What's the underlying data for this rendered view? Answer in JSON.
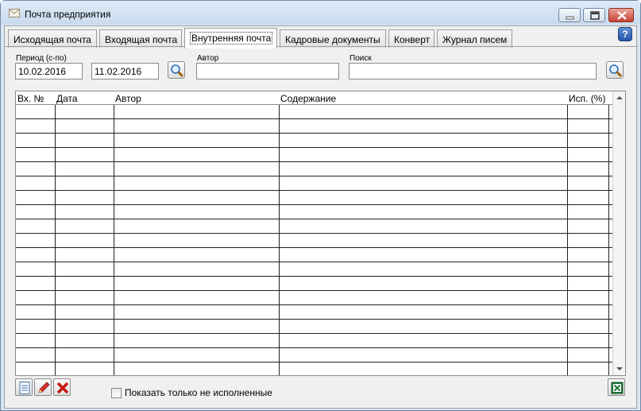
{
  "window": {
    "title": "Почта предприятия"
  },
  "tabs": [
    {
      "label": "Исходящая почта"
    },
    {
      "label": "Входящая почта"
    },
    {
      "label": "Внутренняя почта",
      "active": true
    },
    {
      "label": "Кадровые документы"
    },
    {
      "label": "Конверт"
    },
    {
      "label": "Журнал писем"
    }
  ],
  "help": {
    "label": "?"
  },
  "filters": {
    "period_label": "Период (с-по)",
    "date_from": "10.02.2016",
    "date_to": "11.02.2016",
    "author_label": "Автор",
    "author_value": "",
    "search_label": "Поиск",
    "search_value": ""
  },
  "table": {
    "columns": [
      "Вх. №",
      "Дата",
      "Автор",
      "Содержание",
      "Исп. (%)"
    ],
    "rows": []
  },
  "footer": {
    "checkbox_label": "Показать только не исполненные",
    "checkbox_checked": false
  },
  "icons": {
    "window": "envelope-icon",
    "search": "magnifier-icon",
    "new": "document-icon",
    "edit": "pencil-icon",
    "delete": "red-x-icon",
    "export": "excel-icon"
  }
}
